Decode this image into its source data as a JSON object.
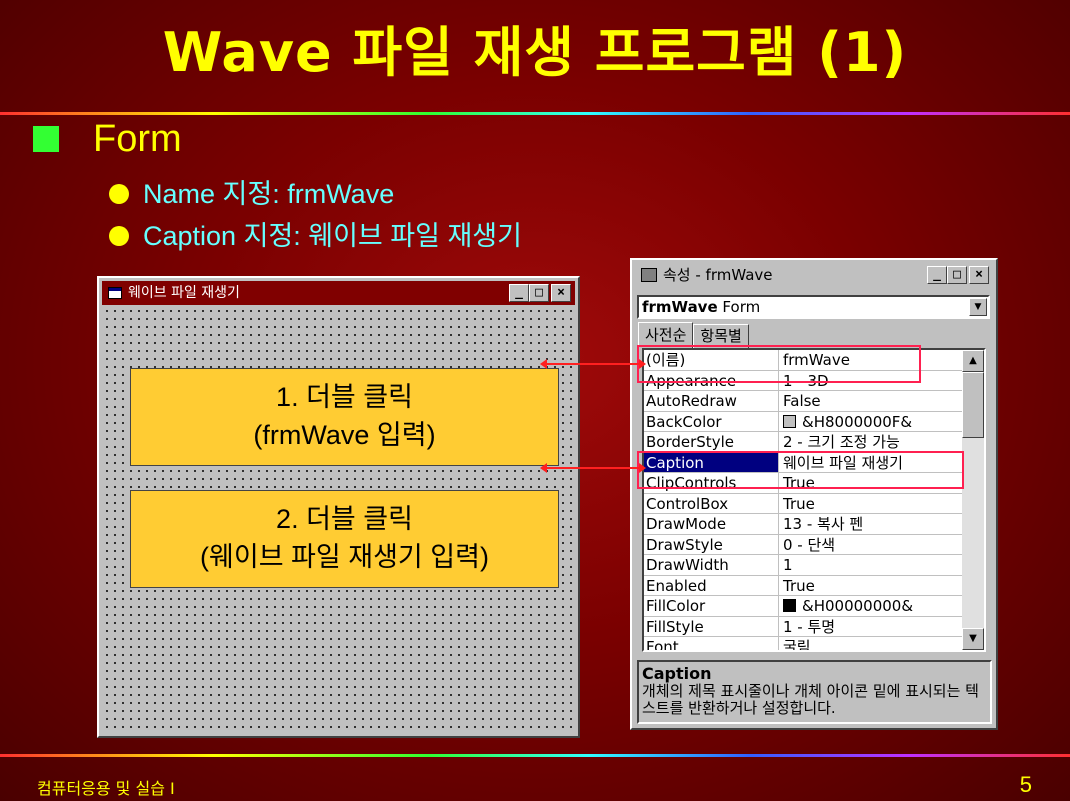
{
  "slide": {
    "title": "Wave 파일 재생 프로그램 (1)",
    "heading": "Form",
    "bullets": [
      "Name 지정: frmWave",
      "Caption 지정: 웨이브 파일 재생기"
    ],
    "footer_left": "컴퓨터응용 및 실습 I",
    "page_number": "5"
  },
  "form_window": {
    "title": "웨이브 파일 재생기",
    "buttons": {
      "minimize": "_",
      "maximize": "□",
      "close": "×"
    },
    "callouts": [
      {
        "line1": "1. 더블 클릭",
        "line2": "(frmWave 입력)"
      },
      {
        "line1": "2. 더블 클릭",
        "line2": "(웨이브 파일 재생기 입력)"
      }
    ]
  },
  "properties_window": {
    "title": "속성 - frmWave",
    "object_combo": {
      "name": "frmWave",
      "type": "Form"
    },
    "tabs": [
      "사전순",
      "항목별"
    ],
    "rows": [
      {
        "name": "(이름)",
        "value": "frmWave"
      },
      {
        "name": "Appearance",
        "value": "1 - 3D"
      },
      {
        "name": "AutoRedraw",
        "value": "False"
      },
      {
        "name": "BackColor",
        "value": "&H8000000F&"
      },
      {
        "name": "BorderStyle",
        "value": "2 - 크기 조정 가능"
      },
      {
        "name": "Caption",
        "value": "웨이브 파일 재생기"
      },
      {
        "name": "ClipControls",
        "value": "True"
      },
      {
        "name": "ControlBox",
        "value": "True"
      },
      {
        "name": "DrawMode",
        "value": "13 - 복사 펜"
      },
      {
        "name": "DrawStyle",
        "value": "0 - 단색"
      },
      {
        "name": "DrawWidth",
        "value": "1"
      },
      {
        "name": "Enabled",
        "value": "True"
      },
      {
        "name": "FillColor",
        "value": "&H00000000&"
      },
      {
        "name": "FillStyle",
        "value": "1 - 투명"
      },
      {
        "name": "Font",
        "value": "굴림"
      }
    ],
    "selected_row": "Caption",
    "swatch_colors": {
      "BackColor": "#c0c0c0",
      "FillColor": "#000000"
    },
    "description": {
      "title": "Caption",
      "text": "개체의 제목 표시줄이나 개체 아이콘 밑에 표시되는 텍스트를 반환하거나 설정합니다."
    }
  },
  "colors": {
    "title": "#ffff00",
    "bullet_square": "#33ff33",
    "bullet_text": "#66ffff",
    "callout_bg": "#ffcc33",
    "highlight": "#ff2050",
    "selection": "#000080"
  }
}
